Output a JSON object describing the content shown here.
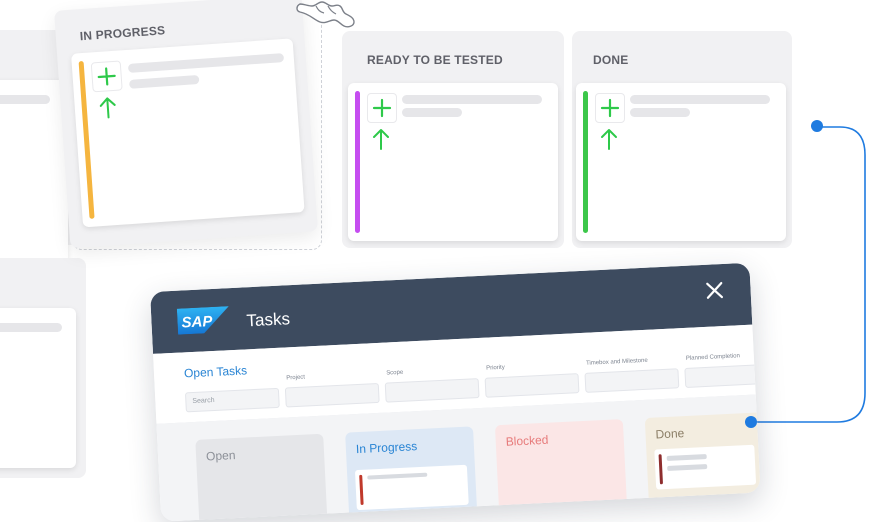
{
  "board": {
    "columns": [
      {
        "title": "IN PROGRESS",
        "stripe_color": "#f5b53f"
      },
      {
        "title": "READY TO BE TESTED",
        "stripe_color": "#c54df0"
      },
      {
        "title": "DONE",
        "stripe_color": "#3cc74a"
      }
    ],
    "add_icon_color": "#2ec94a",
    "arrow_icon_color": "#2ec94a"
  },
  "connector": {
    "color": "#1f7be0"
  },
  "sap_window": {
    "logo_text": "SAP",
    "title": "Tasks",
    "close_icon": "close-icon",
    "filters": {
      "title": "Open Tasks",
      "search_placeholder": "Search",
      "labels": [
        "Project",
        "Scope",
        "Priority",
        "Timebox and Milestone",
        "Planned Completion"
      ]
    },
    "columns": [
      {
        "title": "Open",
        "bg": "#e5e6e9",
        "color": "#8c9098"
      },
      {
        "title": "In Progress",
        "bg": "#dde8f5",
        "color": "#2a85d4"
      },
      {
        "title": "Blocked",
        "bg": "#fbe6e6",
        "color": "#e77b7b"
      },
      {
        "title": "Done",
        "bg": "#f3ede0",
        "color": "#8b7e66"
      }
    ]
  }
}
